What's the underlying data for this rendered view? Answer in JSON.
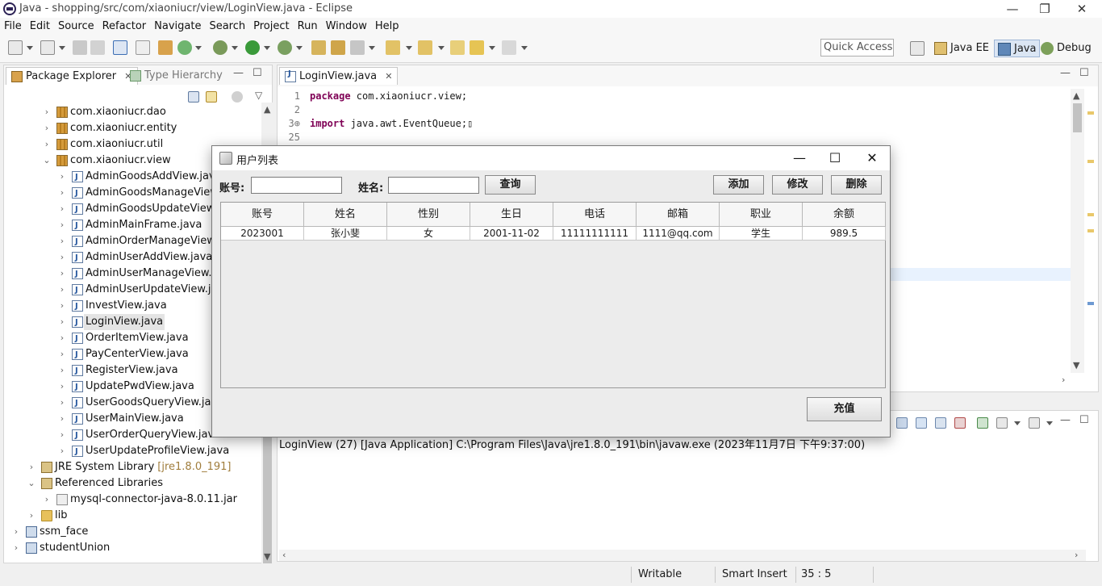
{
  "window": {
    "title": "Java - shopping/src/com/xiaoniucr/view/LoginView.java - Eclipse",
    "controls": {
      "minimize": "—",
      "restore": "❐",
      "close": "✕"
    }
  },
  "menu": [
    "File",
    "Edit",
    "Source",
    "Refactor",
    "Navigate",
    "Search",
    "Project",
    "Run",
    "Window",
    "Help"
  ],
  "toolbar": {
    "quick_access_placeholder": "Quick Access",
    "perspectives": [
      "Java EE",
      "Java",
      "Debug"
    ]
  },
  "package_explorer": {
    "tabs": [
      "Package Explorer",
      "Type Hierarchy"
    ],
    "tree": [
      {
        "label": "com.xiaoniucr.dao",
        "icon": "package-icon",
        "chevron": "›"
      },
      {
        "label": "com.xiaoniucr.entity",
        "icon": "package-icon",
        "chevron": "›"
      },
      {
        "label": "com.xiaoniucr.util",
        "icon": "package-icon",
        "chevron": "›"
      },
      {
        "label": "com.xiaoniucr.view",
        "icon": "package-icon",
        "chevron": "⌄"
      },
      {
        "label": "AdminGoodsAddView.java",
        "icon": "java-file-icon",
        "chevron": "›"
      },
      {
        "label": "AdminGoodsManageView.ja",
        "icon": "java-file-icon",
        "chevron": "›"
      },
      {
        "label": "AdminGoodsUpdateView.ja",
        "icon": "java-file-icon",
        "chevron": "›"
      },
      {
        "label": "AdminMainFrame.java",
        "icon": "java-file-icon",
        "chevron": "›"
      },
      {
        "label": "AdminOrderManageView.ja",
        "icon": "java-file-icon",
        "chevron": "›"
      },
      {
        "label": "AdminUserAddView.java",
        "icon": "java-file-icon",
        "chevron": "›"
      },
      {
        "label": "AdminUserManageView.jav",
        "icon": "java-file-icon",
        "chevron": "›"
      },
      {
        "label": "AdminUserUpdateView.java",
        "icon": "java-file-icon",
        "chevron": "›"
      },
      {
        "label": "InvestView.java",
        "icon": "java-file-icon",
        "chevron": "›"
      },
      {
        "label": "LoginView.java",
        "icon": "java-file-icon",
        "chevron": "›",
        "selected": true
      },
      {
        "label": "OrderItemView.java",
        "icon": "java-file-icon",
        "chevron": "›"
      },
      {
        "label": "PayCenterView.java",
        "icon": "java-file-icon",
        "chevron": "›"
      },
      {
        "label": "RegisterView.java",
        "icon": "java-file-icon",
        "chevron": "›"
      },
      {
        "label": "UpdatePwdView.java",
        "icon": "java-file-icon",
        "chevron": "›"
      },
      {
        "label": "UserGoodsQueryView.java",
        "icon": "java-file-icon",
        "chevron": "›"
      },
      {
        "label": "UserMainView.java",
        "icon": "java-file-icon",
        "chevron": "›"
      },
      {
        "label": "UserOrderQueryView.java",
        "icon": "java-file-icon",
        "chevron": "›"
      },
      {
        "label": "UserUpdateProfileView.java",
        "icon": "java-file-icon",
        "chevron": "›"
      },
      {
        "label": "JRE System Library",
        "decoration": "[jre1.8.0_191]",
        "icon": "library-icon",
        "chevron": "›"
      },
      {
        "label": "Referenced Libraries",
        "icon": "library-icon",
        "chevron": "⌄"
      },
      {
        "label": "mysql-connector-java-8.0.11.jar",
        "icon": "jar-icon",
        "chevron": "›"
      },
      {
        "label": "lib",
        "icon": "folder-icon",
        "chevron": "›"
      },
      {
        "label": "ssm_face",
        "icon": "project-icon",
        "chevron": "›"
      },
      {
        "label": "studentUnion",
        "icon": "project-icon",
        "chevron": "›"
      }
    ]
  },
  "editor": {
    "tab_label": "LoginView.java",
    "lines": [
      {
        "num": "1",
        "kw": "package",
        "rest": " com.xiaoniucr.view;"
      },
      {
        "num": "2",
        "kw": "",
        "rest": ""
      },
      {
        "num": "3⊕",
        "kw": "import",
        "rest": " java.awt.EventQueue;▯"
      },
      {
        "num": "25",
        "kw": "",
        "rest": ""
      }
    ]
  },
  "console": {
    "header": "LoginView (27) [Java Application] C:\\Program Files\\Java\\jre1.8.0_191\\bin\\javaw.exe (2023年11月7日 下午9:37:00)"
  },
  "status": {
    "writable": "Writable",
    "insert_mode": "Smart Insert",
    "position": "35 : 5"
  },
  "dialog": {
    "title": "用户列表",
    "controls": {
      "minimize": "—",
      "maximize": "☐",
      "close": "✕"
    },
    "account_label": "账号:",
    "account_value": "",
    "name_label": "姓名:",
    "name_value": "",
    "query_button": "查询",
    "add_button": "添加",
    "edit_button": "修改",
    "delete_button": "删除",
    "recharge_button": "充值",
    "table": {
      "columns": [
        "账号",
        "姓名",
        "性别",
        "生日",
        "电话",
        "邮箱",
        "职业",
        "余额"
      ],
      "rows": [
        [
          "2023001",
          "张小斐",
          "女",
          "2001-11-02",
          "11111111111",
          "1111@qq.com",
          "学生",
          "989.5"
        ]
      ]
    }
  },
  "colors": {
    "keyword": "#7f0055",
    "selection": "#e4e4e4",
    "library_decoration": "#a07d3c"
  }
}
